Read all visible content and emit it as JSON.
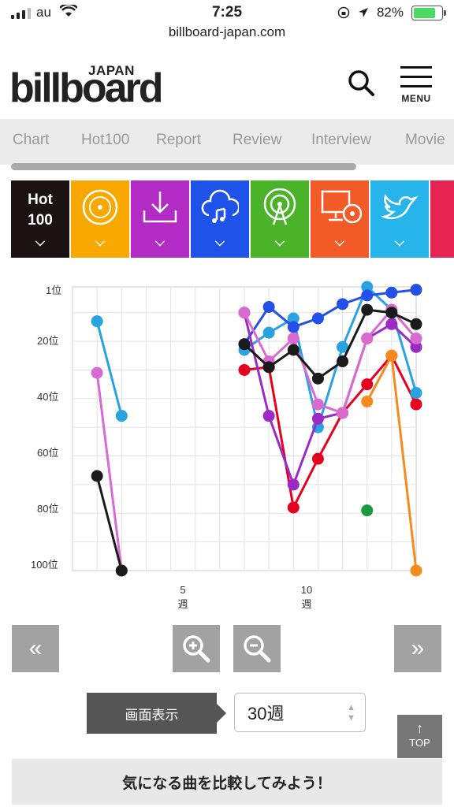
{
  "status_bar": {
    "carrier": "au",
    "time": "7:25",
    "battery": "82%",
    "url": "billboard-japan.com"
  },
  "header": {
    "logo_text": "billboard",
    "logo_japan": "JAPAN",
    "menu_label": "MENU"
  },
  "nav": {
    "tabs": [
      "Chart",
      "Hot100",
      "Report",
      "Review",
      "Interview",
      "Movie"
    ]
  },
  "categories": [
    {
      "name": "hot100",
      "line1": "Hot",
      "line2": "100",
      "color": "#1b1311"
    },
    {
      "name": "cd-sales",
      "color": "#f8a800"
    },
    {
      "name": "download",
      "color": "#b22bc4"
    },
    {
      "name": "streaming",
      "color": "#1e52e8"
    },
    {
      "name": "radio",
      "color": "#4ab32a"
    },
    {
      "name": "lookup",
      "color": "#f25b27"
    },
    {
      "name": "twitter",
      "color": "#27b4ea"
    },
    {
      "name": "extra",
      "color": "#e52454"
    }
  ],
  "chart_data": {
    "type": "line",
    "y_axis": {
      "labels": [
        "1位",
        "20位",
        "40位",
        "60位",
        "80位",
        "100位"
      ],
      "ticks": [
        1,
        20,
        40,
        60,
        80,
        100
      ],
      "inverted": true,
      "range": [
        1,
        100
      ]
    },
    "x_axis": {
      "tick_weeks": [
        5,
        10
      ],
      "tick_unit": "週",
      "range": [
        0,
        14
      ]
    },
    "series": [
      {
        "color": "#e6001f",
        "points": [
          [
            7,
            30
          ],
          [
            8,
            29
          ],
          [
            9,
            78
          ],
          [
            10,
            61
          ],
          [
            11,
            45
          ],
          [
            12,
            35
          ],
          [
            13,
            25
          ],
          [
            14,
            42
          ]
        ]
      },
      {
        "color": "#f58a1f",
        "points": [
          [
            12,
            41
          ],
          [
            13,
            25
          ],
          [
            14,
            100
          ]
        ]
      },
      {
        "color": "#1a9c3e",
        "points": [
          [
            12,
            79
          ]
        ]
      },
      {
        "color": "#29a3e0",
        "points": [
          [
            1,
            13
          ],
          [
            2,
            46
          ],
          [
            7,
            23
          ],
          [
            8,
            17
          ],
          [
            9,
            12
          ],
          [
            10,
            50
          ],
          [
            11,
            22
          ],
          [
            12,
            1
          ],
          [
            13,
            9
          ],
          [
            14,
            38
          ]
        ]
      },
      {
        "color": "#2350e6",
        "points": [
          [
            7,
            21
          ],
          [
            8,
            8
          ],
          [
            9,
            15
          ],
          [
            10,
            12
          ],
          [
            11,
            7
          ],
          [
            12,
            4
          ],
          [
            13,
            3
          ],
          [
            14,
            2
          ]
        ]
      },
      {
        "color": "#9b2bc4",
        "points": [
          [
            7,
            10
          ],
          [
            8,
            46
          ],
          [
            9,
            70
          ],
          [
            10,
            47
          ],
          [
            11,
            45
          ],
          [
            12,
            19
          ],
          [
            13,
            14
          ],
          [
            14,
            22
          ]
        ]
      },
      {
        "color": "#d96ad0",
        "points": [
          [
            1,
            31
          ],
          [
            2,
            100
          ],
          [
            7,
            10
          ],
          [
            8,
            27
          ],
          [
            9,
            19
          ],
          [
            10,
            42
          ],
          [
            11,
            45
          ],
          [
            12,
            19
          ],
          [
            13,
            9
          ],
          [
            14,
            19
          ]
        ]
      },
      {
        "color": "#1a1a1a",
        "points": [
          [
            1,
            67
          ],
          [
            2,
            100
          ],
          [
            7,
            21
          ],
          [
            8,
            29
          ],
          [
            9,
            23
          ],
          [
            10,
            33
          ],
          [
            11,
            27
          ],
          [
            12,
            9
          ],
          [
            13,
            10
          ],
          [
            14,
            14
          ]
        ]
      }
    ]
  },
  "controls": {
    "prev": "«",
    "next": "»",
    "display_label": "画面表示",
    "weeks_value": "30週",
    "top_label": "TOP",
    "compare_label": "気になる曲を比較してみよう！"
  }
}
